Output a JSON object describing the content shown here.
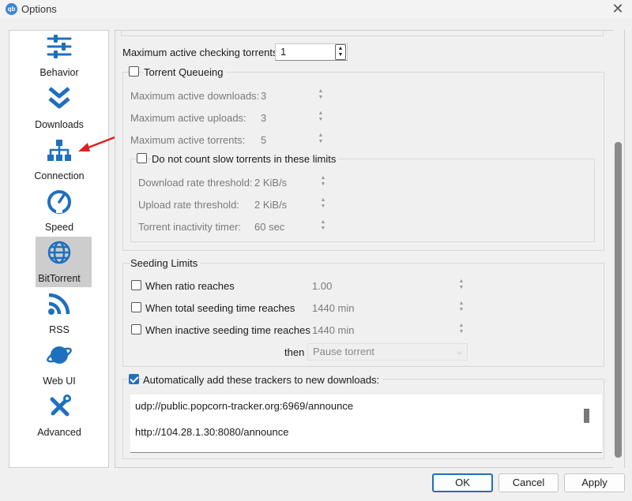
{
  "window": {
    "title": "Options",
    "app_icon_text": "qb"
  },
  "sidebar": {
    "items": [
      {
        "label": "Behavior",
        "icon": "sliders-icon"
      },
      {
        "label": "Downloads",
        "icon": "double-chevron-down-icon"
      },
      {
        "label": "Connection",
        "icon": "network-icon"
      },
      {
        "label": "Speed",
        "icon": "speedometer-icon"
      },
      {
        "label": "BitTorrent",
        "icon": "globe-icon",
        "selected": true
      },
      {
        "label": "RSS",
        "icon": "rss-icon"
      },
      {
        "label": "Web UI",
        "icon": "planet-icon"
      },
      {
        "label": "Advanced",
        "icon": "tools-icon"
      }
    ],
    "accent_color": "#1f6fbf",
    "arrow_color": "#e02020"
  },
  "checking": {
    "label": "Maximum active checking torrents:",
    "value": "1"
  },
  "queueing": {
    "label": "Torrent Queueing",
    "checked": false,
    "downloads_label": "Maximum active downloads:",
    "downloads_value": "3",
    "uploads_label": "Maximum active uploads:",
    "uploads_value": "3",
    "torrents_label": "Maximum active torrents:",
    "torrents_value": "5",
    "slow": {
      "label": "Do not count slow torrents in these limits",
      "checked": false,
      "dl_label": "Download rate threshold:",
      "dl_value": "2 KiB/s",
      "ul_label": "Upload rate threshold:",
      "ul_value": "2 KiB/s",
      "inactivity_label": "Torrent inactivity timer:",
      "inactivity_value": "60 sec"
    }
  },
  "seeding": {
    "title": "Seeding Limits",
    "ratio_label": "When ratio reaches",
    "ratio_value": "1.00",
    "total_label": "When total seeding time reaches",
    "total_value": "1440 min",
    "inactive_label": "When inactive seeding time reaches",
    "inactive_value": "1440 min",
    "then_label": "then",
    "then_value": "Pause torrent"
  },
  "trackers": {
    "label": "Automatically add these trackers to new downloads:",
    "checked": true,
    "lines": [
      "udp://public.popcorn-tracker.org:6969/announce",
      "http://104.28.1.30:8080/announce"
    ]
  },
  "buttons": {
    "ok": "OK",
    "cancel": "Cancel",
    "apply": "Apply"
  }
}
